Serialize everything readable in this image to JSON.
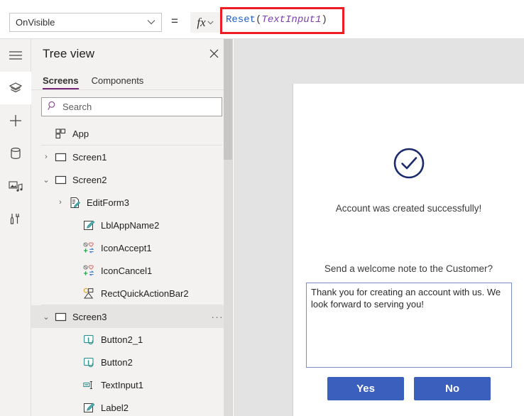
{
  "formula_bar": {
    "property_dropdown": {
      "value": "OnVisible",
      "chevron": "chevron-down-icon"
    },
    "equals": "=",
    "fx_label": "fx",
    "fx_chevron": "⌄",
    "formula": {
      "function_name": "Reset",
      "open_paren": "(",
      "argument": "TextInput1",
      "close_paren": ")",
      "full_text": "Reset(TextInput1)"
    },
    "highlight_color": "#ee1c25",
    "function_color": "#2060c0",
    "argument_color": "#7a3fb0"
  },
  "icon_rail": {
    "items": [
      {
        "name": "hamburger-menu-icon",
        "active": false
      },
      {
        "name": "tree-view-layers-icon",
        "active": true
      },
      {
        "name": "insert-plus-icon",
        "active": false
      },
      {
        "name": "data-cylinder-icon",
        "active": false
      },
      {
        "name": "media-icon",
        "active": false
      },
      {
        "name": "advanced-tools-icon",
        "active": false
      }
    ]
  },
  "tree_panel": {
    "title": "Tree view",
    "close_label": "✕",
    "tabs": [
      {
        "label": "Screens",
        "active": true
      },
      {
        "label": "Components",
        "active": false
      }
    ],
    "search": {
      "placeholder": "Search",
      "value": "",
      "icon": "search-icon"
    },
    "accent_color": "#742774",
    "items": [
      {
        "label": "App",
        "indent": 0,
        "twisty": "",
        "icon": "app-grid-icon",
        "selected": false,
        "ellipsis": false,
        "separator_after": true
      },
      {
        "label": "Screen1",
        "indent": 0,
        "twisty": "›",
        "icon": "screen-rect-icon",
        "selected": false,
        "ellipsis": false,
        "separator_after": false
      },
      {
        "label": "Screen2",
        "indent": 0,
        "twisty": "⌄",
        "icon": "screen-rect-icon",
        "selected": false,
        "ellipsis": false,
        "separator_after": false
      },
      {
        "label": "EditForm3",
        "indent": 1,
        "twisty": "›",
        "icon": "edit-form-icon",
        "selected": false,
        "ellipsis": false,
        "separator_after": false
      },
      {
        "label": "LblAppName2",
        "indent": 2,
        "twisty": "",
        "icon": "label-pencil-icon",
        "selected": false,
        "ellipsis": false,
        "separator_after": false
      },
      {
        "label": "IconAccept1",
        "indent": 2,
        "twisty": "",
        "icon": "icon-set-icon",
        "selected": false,
        "ellipsis": false,
        "separator_after": false
      },
      {
        "label": "IconCancel1",
        "indent": 2,
        "twisty": "",
        "icon": "icon-set-icon",
        "selected": false,
        "ellipsis": false,
        "separator_after": false
      },
      {
        "label": "RectQuickActionBar2",
        "indent": 2,
        "twisty": "",
        "icon": "shape-rect-icon",
        "selected": false,
        "ellipsis": false,
        "separator_after": true
      },
      {
        "label": "Screen3",
        "indent": 0,
        "twisty": "⌄",
        "icon": "screen-rect-icon",
        "selected": true,
        "ellipsis": true,
        "separator_after": false
      },
      {
        "label": "Button2_1",
        "indent": 2,
        "twisty": "",
        "icon": "button-icon",
        "selected": false,
        "ellipsis": false,
        "separator_after": false
      },
      {
        "label": "Button2",
        "indent": 2,
        "twisty": "",
        "icon": "button-icon",
        "selected": false,
        "ellipsis": false,
        "separator_after": false
      },
      {
        "label": "TextInput1",
        "indent": 2,
        "twisty": "",
        "icon": "text-input-icon",
        "selected": false,
        "ellipsis": false,
        "separator_after": false
      },
      {
        "label": "Label2",
        "indent": 2,
        "twisty": "",
        "icon": "label-pencil-icon",
        "selected": false,
        "ellipsis": false,
        "separator_after": false
      }
    ],
    "ellipsis_label": "···"
  },
  "canvas": {
    "background_color": "#e3e3e3",
    "app_screen": {
      "check_icon": "success-check-circle-icon",
      "check_color": "#1a2a6c",
      "success_message": "Account was created successfully!",
      "prompt_message": "Send a welcome note to the Customer?",
      "note_textarea": {
        "value": "Thank you for creating an account with us. We look forward to serving you!",
        "border_color": "#7b8bc4"
      },
      "buttons": [
        {
          "label": "Yes",
          "color": "#3a5fbd"
        },
        {
          "label": "No",
          "color": "#3a5fbd"
        }
      ]
    }
  }
}
